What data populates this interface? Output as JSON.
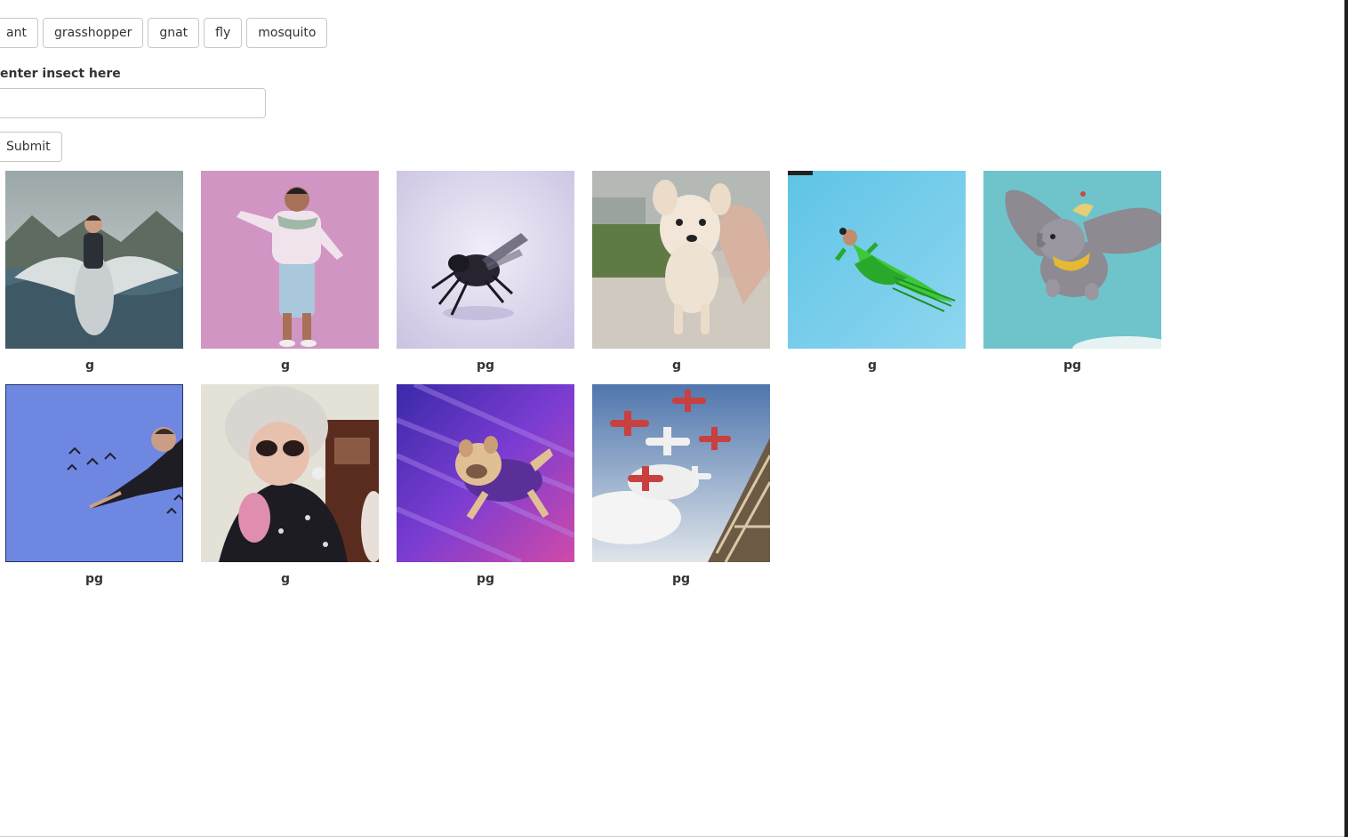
{
  "tags": [
    "ant",
    "grasshopper",
    "gnat",
    "fly",
    "mosquito"
  ],
  "form": {
    "label": "enter insect here",
    "input_value": "",
    "submit_label": "Submit"
  },
  "gifs": [
    {
      "rating": "g"
    },
    {
      "rating": "g"
    },
    {
      "rating": "pg"
    },
    {
      "rating": "g"
    },
    {
      "rating": "g"
    },
    {
      "rating": "pg"
    },
    {
      "rating": "pg"
    },
    {
      "rating": "g"
    },
    {
      "rating": "pg"
    },
    {
      "rating": "pg"
    }
  ]
}
